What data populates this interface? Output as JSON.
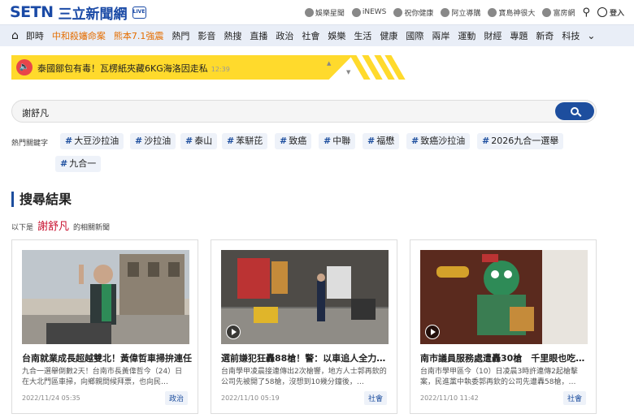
{
  "header": {
    "logo_text": "SETN",
    "logo_zh": "三立新聞網",
    "live_label": "LIVE",
    "links": [
      {
        "label": "娛樂星聞",
        "icon": "star-icon"
      },
      {
        "label": "iNEWS",
        "icon": "inews-icon"
      },
      {
        "label": "祝你健康",
        "icon": "health-icon"
      },
      {
        "label": "阿立導購",
        "icon": "shop-icon"
      },
      {
        "label": "寶島神很大",
        "icon": "temple-icon"
      },
      {
        "label": "富房網",
        "icon": "house-icon"
      }
    ],
    "login_label": "登入"
  },
  "nav": {
    "items": [
      "即時",
      "中和殺嬸命案",
      "熊本7.1強震",
      "熱門",
      "影音",
      "熱搜",
      "直播",
      "政治",
      "社會",
      "娛樂",
      "生活",
      "健康",
      "國際",
      "兩岸",
      "運動",
      "財經",
      "專題",
      "新奇",
      "科技"
    ]
  },
  "ticker": {
    "text": "泰國鄒包有毒！瓦楞紙夾藏6KG海洛因走私",
    "time": "12:39"
  },
  "search": {
    "value": "謝舒凡"
  },
  "keywords": {
    "label": "熱門關鍵字",
    "items": [
      "大豆沙拉油",
      "沙拉油",
      "泰山",
      "苯駢芘",
      "致癌",
      "中聯",
      "福懋",
      "致癌沙拉油",
      "2026九合一選舉",
      "九合一"
    ]
  },
  "results": {
    "title": "搜尋結果",
    "sub_prefix": "以下是",
    "keyword": "謝舒凡",
    "sub_suffix": "的相關新聞",
    "cards": [
      {
        "title": "台南就業成長超越雙北！黃偉哲車掃拚連任",
        "desc": "九合一選舉倒數2天！台南市長黃偉哲今（24）日在大北門區車掃，向鄉親問候拜票，也向民…",
        "date": "2022/11/24 05:35",
        "tag": "政治"
      },
      {
        "title": "選前嫌犯狂轟88槍！警：以車追人全力…",
        "desc": "台南學甲凌晨接連傳出2次槍響，地方人士郭再欽的公司先被開了58槍，沒想到10幾分鐘後，…",
        "date": "2022/11/10 05:19",
        "tag": "社會"
      },
      {
        "title": "南市議員服務處遭轟30槍　千里眼也吃…",
        "desc": "台南市學甲區今（10）日凌晨3時許連傳2起槍擊案，民進黨中執委郭再欽的公司先遭轟58槍，…",
        "date": "2022/11/10 11:42",
        "tag": "社會"
      }
    ]
  }
}
